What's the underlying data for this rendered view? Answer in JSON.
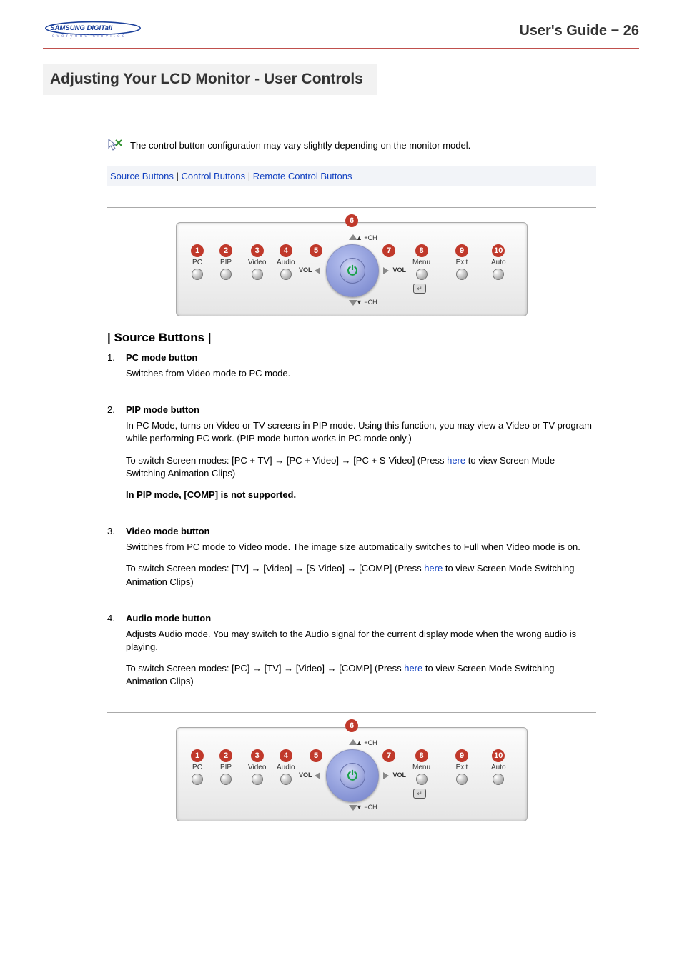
{
  "header": {
    "logo_text_main": "SAMSUNG DIGITall",
    "logo_text_sub": "everyone's invited",
    "guide_label": "User's Guide",
    "page_number": "26"
  },
  "title": "Adjusting Your LCD Monitor - User Controls",
  "note": "The control button configuration may vary slightly depending on the monitor model.",
  "links": {
    "source": "Source Buttons",
    "control": "Control Buttons",
    "remote": "Remote Control Buttons"
  },
  "panel": {
    "buttons": [
      {
        "num": "1",
        "label": "PC"
      },
      {
        "num": "2",
        "label": "PIP"
      },
      {
        "num": "3",
        "label": "Video"
      },
      {
        "num": "4",
        "label": "Audio"
      },
      {
        "num": "5",
        "label": ""
      },
      {
        "num": "7",
        "label": ""
      },
      {
        "num": "8",
        "label": "Menu"
      },
      {
        "num": "9",
        "label": "Exit"
      },
      {
        "num": "10",
        "label": "Auto"
      }
    ],
    "center_num": "6",
    "ch_plus": "+CH",
    "ch_minus": "−CH",
    "vol": "VOL"
  },
  "section1": {
    "heading": "| Source Buttons |",
    "items": [
      {
        "n": "1.",
        "title": "PC mode button",
        "p1": "Switches from Video mode to PC mode."
      },
      {
        "n": "2.",
        "title": "PIP mode button",
        "p1": "In PC Mode, turns on Video or TV screens in PIP mode. Using this function, you may view a Video or TV program while performing PC work. (PIP mode button works in PC mode only.)",
        "p2_a": "To switch Screen modes: [PC + TV]  ",
        "p2_b": "  [PC + Video]  ",
        "p2_c": "  [PC + S-Video] (Press ",
        "p2_link": "here",
        "p2_d": " to view Screen Mode Switching Animation Clips)",
        "p3": "In PIP mode, [COMP] is not supported."
      },
      {
        "n": "3.",
        "title": "Video mode button",
        "p1": "Switches from PC mode to Video mode. The image size automatically switches to Full when Video mode is on.",
        "p2_a": "To switch Screen modes: [TV]  ",
        "p2_b": "  [Video]  ",
        "p2_c": "  [S-Video]  ",
        "p2_d": "  [COMP] (Press ",
        "p2_link": "here",
        "p2_e": " to view Screen Mode Switching Animation Clips)"
      },
      {
        "n": "4.",
        "title": "Audio mode button",
        "p1": "Adjusts Audio mode. You may switch to the Audio signal for the current display mode when the wrong audio is playing.",
        "p2_a": "To switch Screen modes: [PC]  ",
        "p2_b": "  [TV]  ",
        "p2_c": "  [Video]  ",
        "p2_d": "  [COMP] (Press ",
        "p2_link": "here",
        "p2_e": " to view Screen Mode Switching Animation Clips)"
      }
    ]
  },
  "arrow": "→"
}
